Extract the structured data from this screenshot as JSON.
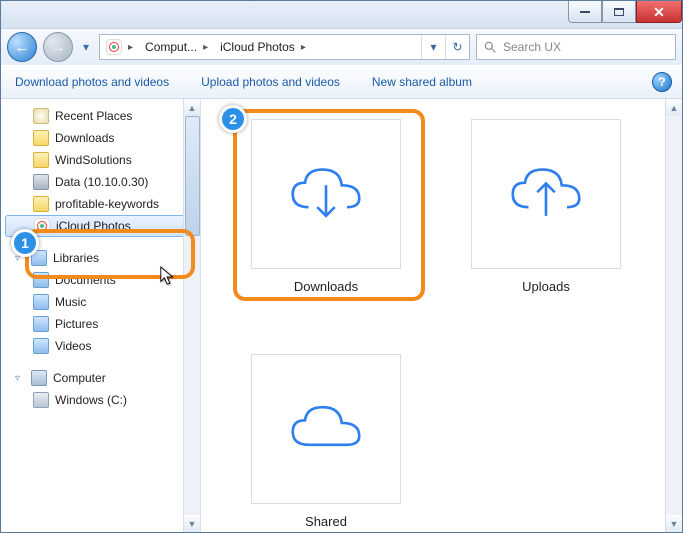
{
  "breadcrumbs": {
    "seg1": "Comput...",
    "seg2": "iCloud Photos"
  },
  "search": {
    "placeholder": "Search UX"
  },
  "toolbar": {
    "download": "Download photos and videos",
    "upload": "Upload photos and videos",
    "newalbum": "New shared album"
  },
  "sidebar": {
    "recent": "Recent Places",
    "downloads": "Downloads",
    "windsolutions": "WindSolutions",
    "data": "Data (10.10.0.30)",
    "profitable": "profitable-keywords",
    "icloud": "iCloud Photos",
    "libraries": "Libraries",
    "documents": "Documents",
    "music": "Music",
    "pictures": "Pictures",
    "videos": "Videos",
    "computer": "Computer",
    "drive_c": "Windows (C:)"
  },
  "folders": {
    "downloads": "Downloads",
    "uploads": "Uploads",
    "shared": "Shared"
  },
  "annotations": {
    "step1": "1",
    "step2": "2"
  }
}
